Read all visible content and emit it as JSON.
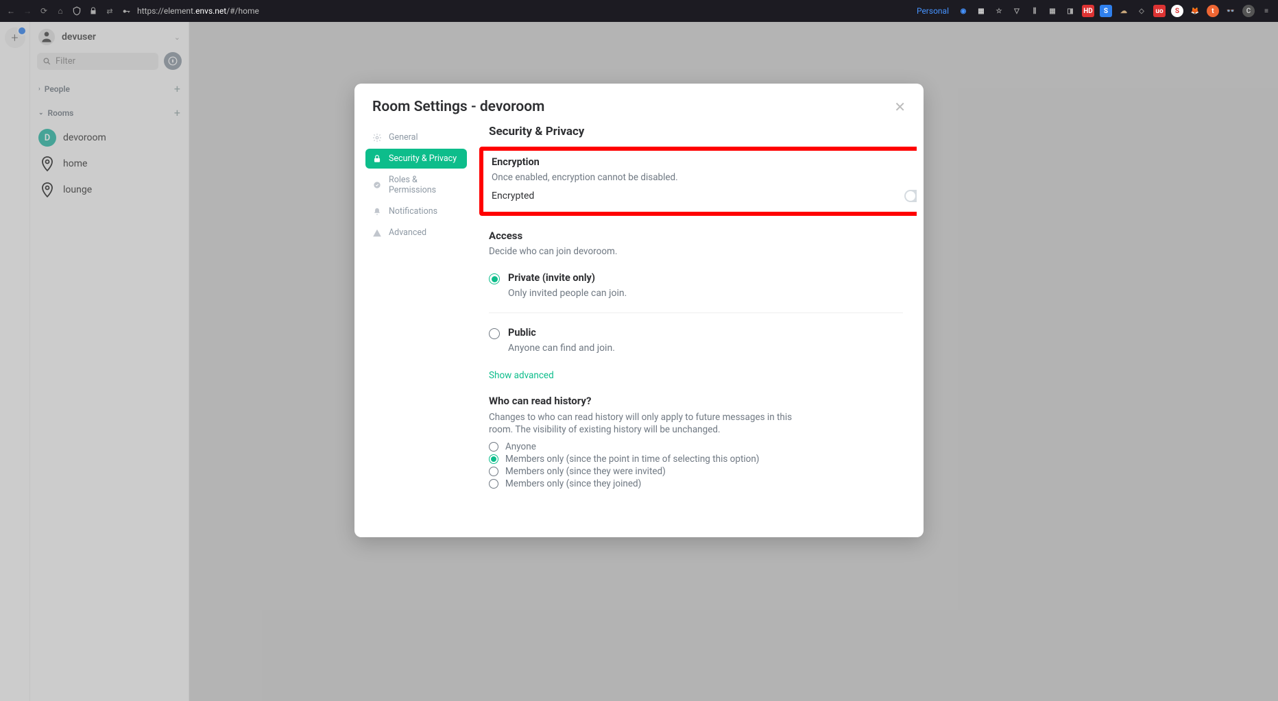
{
  "browser": {
    "url_prefix": "https://element.",
    "url_host": "envs.net",
    "url_path": "/#/home",
    "personal_label": "Personal"
  },
  "sidebar": {
    "user_name": "devuser",
    "filter_placeholder": "Filter",
    "sections": {
      "people": "People",
      "rooms": "Rooms"
    },
    "room_items": [
      {
        "label": "devoroom",
        "avatar_letter": "D",
        "avatar_kind": "d"
      },
      {
        "label": "home",
        "avatar_kind": "pin"
      },
      {
        "label": "lounge",
        "avatar_kind": "pin"
      }
    ]
  },
  "modal": {
    "title": "Room Settings - devoroom",
    "tabs": {
      "general": "General",
      "security": "Security & Privacy",
      "roles": "Roles & Permissions",
      "notifications": "Notifications",
      "advanced": "Advanced"
    },
    "content": {
      "heading": "Security & Privacy",
      "encryption": {
        "title": "Encryption",
        "desc": "Once enabled, encryption cannot be disabled.",
        "toggle_label": "Encrypted",
        "toggle_on": false
      },
      "access": {
        "title": "Access",
        "desc": "Decide who can join devoroom.",
        "options": [
          {
            "title": "Private (invite only)",
            "sub": "Only invited people can join.",
            "selected": true
          },
          {
            "title": "Public",
            "sub": "Anyone can find and join.",
            "selected": false
          }
        ],
        "show_advanced": "Show advanced"
      },
      "history": {
        "title": "Who can read history?",
        "desc": "Changes to who can read history will only apply to future messages in this room. The visibility of existing history will be unchanged.",
        "options": [
          {
            "label": "Anyone",
            "selected": false
          },
          {
            "label": "Members only (since the point in time of selecting this option)",
            "selected": true
          },
          {
            "label": "Members only (since they were invited)",
            "selected": false
          },
          {
            "label": "Members only (since they joined)",
            "selected": false
          }
        ]
      }
    }
  }
}
